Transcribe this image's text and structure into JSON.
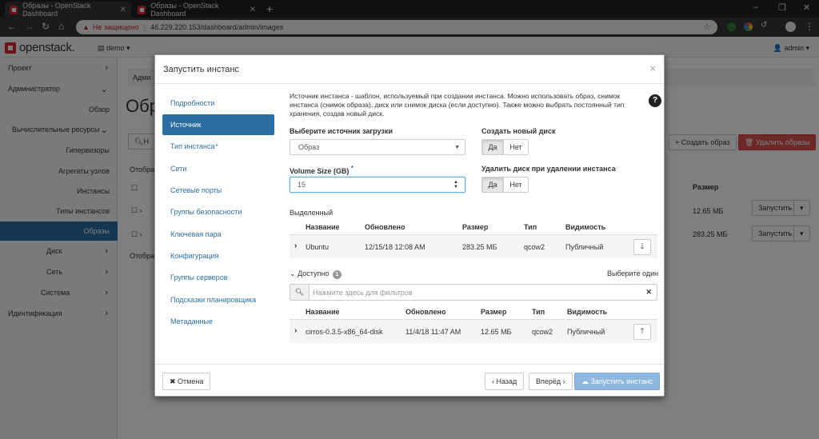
{
  "browser": {
    "tabs": [
      {
        "title": "Образы - OpenStack Dashboard"
      },
      {
        "title": "Образы - OpenStack Dashboard"
      }
    ],
    "security_label": "Не защищено",
    "url": "46.229.220.153/dashboard/admin/images"
  },
  "header": {
    "logo": "openstack.",
    "project": "demo ▾",
    "user": "admin ▾"
  },
  "sidebar": {
    "items": [
      {
        "label": "Проект"
      },
      {
        "label": "Администратор"
      },
      {
        "label": "Обзор"
      },
      {
        "label": "Вычислительные ресурсы"
      },
      {
        "label": "Гипервизоры"
      },
      {
        "label": "Агрегаты узлов"
      },
      {
        "label": "Инстансы"
      },
      {
        "label": "Типы инстансов"
      },
      {
        "label": "Образы"
      },
      {
        "label": "Диск"
      },
      {
        "label": "Сеть"
      },
      {
        "label": "Система"
      },
      {
        "label": "Идентификация"
      }
    ]
  },
  "background": {
    "crumb": "Адми",
    "title": "Обр",
    "filter_prefix": "Н",
    "shown1": "Отобра",
    "shown2": "Отобра",
    "create_btn": "+ Создать образ",
    "delete_btn": "🗑 Удалить образы",
    "size_header": "Размер",
    "rows": [
      {
        "size": "12.65 МБ",
        "action": "Запустить"
      },
      {
        "size": "283.25 МБ",
        "action": "Запустить"
      }
    ]
  },
  "modal": {
    "title": "Запустить инстанс",
    "close": "×",
    "nav": [
      {
        "label": "Подробности"
      },
      {
        "label": "Источник"
      },
      {
        "label": "Тип инстанса"
      },
      {
        "label": "Сети"
      },
      {
        "label": "Сетевые порты"
      },
      {
        "label": "Группы безопасности"
      },
      {
        "label": "Ключевая пара"
      },
      {
        "label": "Конфигурация"
      },
      {
        "label": "Группы серверов"
      },
      {
        "label": "Подсказки планировщика"
      },
      {
        "label": "Метаданные"
      }
    ],
    "intro": "Источник инстанса - шаблон, используемый при создании инстанса. Можно использовать образ, снимок инстанса (снимок образа), диск или снимок диска (если доступно). Также можно выбрать постоянный тип хранения, создав новый диск.",
    "help": "?",
    "boot_source_label": "Выберите источник загрузки",
    "boot_source_value": "Образ",
    "new_volume_label": "Создать новый диск",
    "yes": "Да",
    "no": "Нет",
    "volume_size_label": "Volume Size (GB)",
    "volume_size_value": "15",
    "delete_volume_label": "Удалить диск при удалении инстанса",
    "allocated": {
      "title": "Выделенный",
      "headers": [
        "Название",
        "Обновлено",
        "Размер",
        "Тип",
        "Видимость"
      ],
      "rows": [
        {
          "name": "Ubuntu",
          "updated": "12/15/18 12:08 AM",
          "size": "283.25 МБ",
          "type": "qcow2",
          "visibility": "Публичный"
        }
      ]
    },
    "available": {
      "title": "Доступно",
      "count": "1",
      "select_one": "Выберите один",
      "filter_placeholder": "Нажмите здесь для фильтров",
      "headers": [
        "Название",
        "Обновлено",
        "Размер",
        "Тип",
        "Видимость"
      ],
      "rows": [
        {
          "name": "cirros-0.3.5-x86_64-disk",
          "updated": "11/4/18 11:47 AM",
          "size": "12.65 МБ",
          "type": "qcow2",
          "visibility": "Публичный"
        }
      ]
    },
    "footer": {
      "cancel": "✖ Отмена",
      "back": "‹ Назад",
      "next": "Вперёд ›",
      "launch": "☁ Запустить инстанс"
    }
  }
}
